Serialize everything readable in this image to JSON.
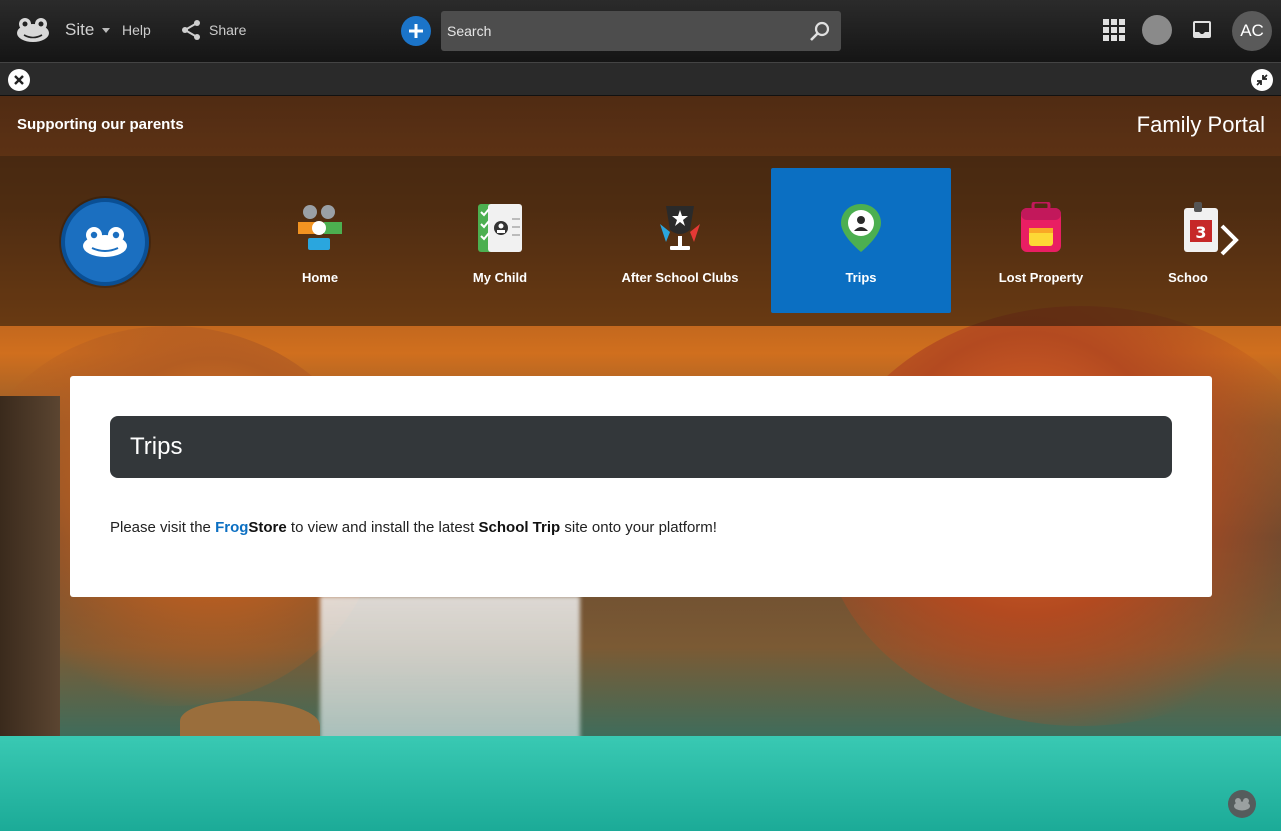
{
  "topbar": {
    "site_label": "Site",
    "help_label": "Help",
    "share_label": "Share",
    "search_placeholder": "Search",
    "avatar_initials": "AC"
  },
  "header": {
    "tagline": "Supporting our parents",
    "portal_title": "Family Portal"
  },
  "nav": {
    "items": [
      {
        "label": "Home",
        "icon": "people-icon"
      },
      {
        "label": "My Child",
        "icon": "contact-card-icon"
      },
      {
        "label": "After School Clubs",
        "icon": "trophy-icon"
      },
      {
        "label": "Trips",
        "icon": "map-pin-icon",
        "active": true
      },
      {
        "label": "Lost Property",
        "icon": "backpack-icon"
      },
      {
        "label": "Schoo",
        "icon": "calendar-icon"
      }
    ]
  },
  "content": {
    "title": "Trips",
    "text_prefix": "Please visit the ",
    "frog": "Frog",
    "store": "Store",
    "text_mid": " to view and install the latest ",
    "school_trip": "School Trip",
    "text_suffix": " site onto your platform!"
  },
  "colors": {
    "accent": "#0b6fc2",
    "title_bar": "#33373a"
  }
}
